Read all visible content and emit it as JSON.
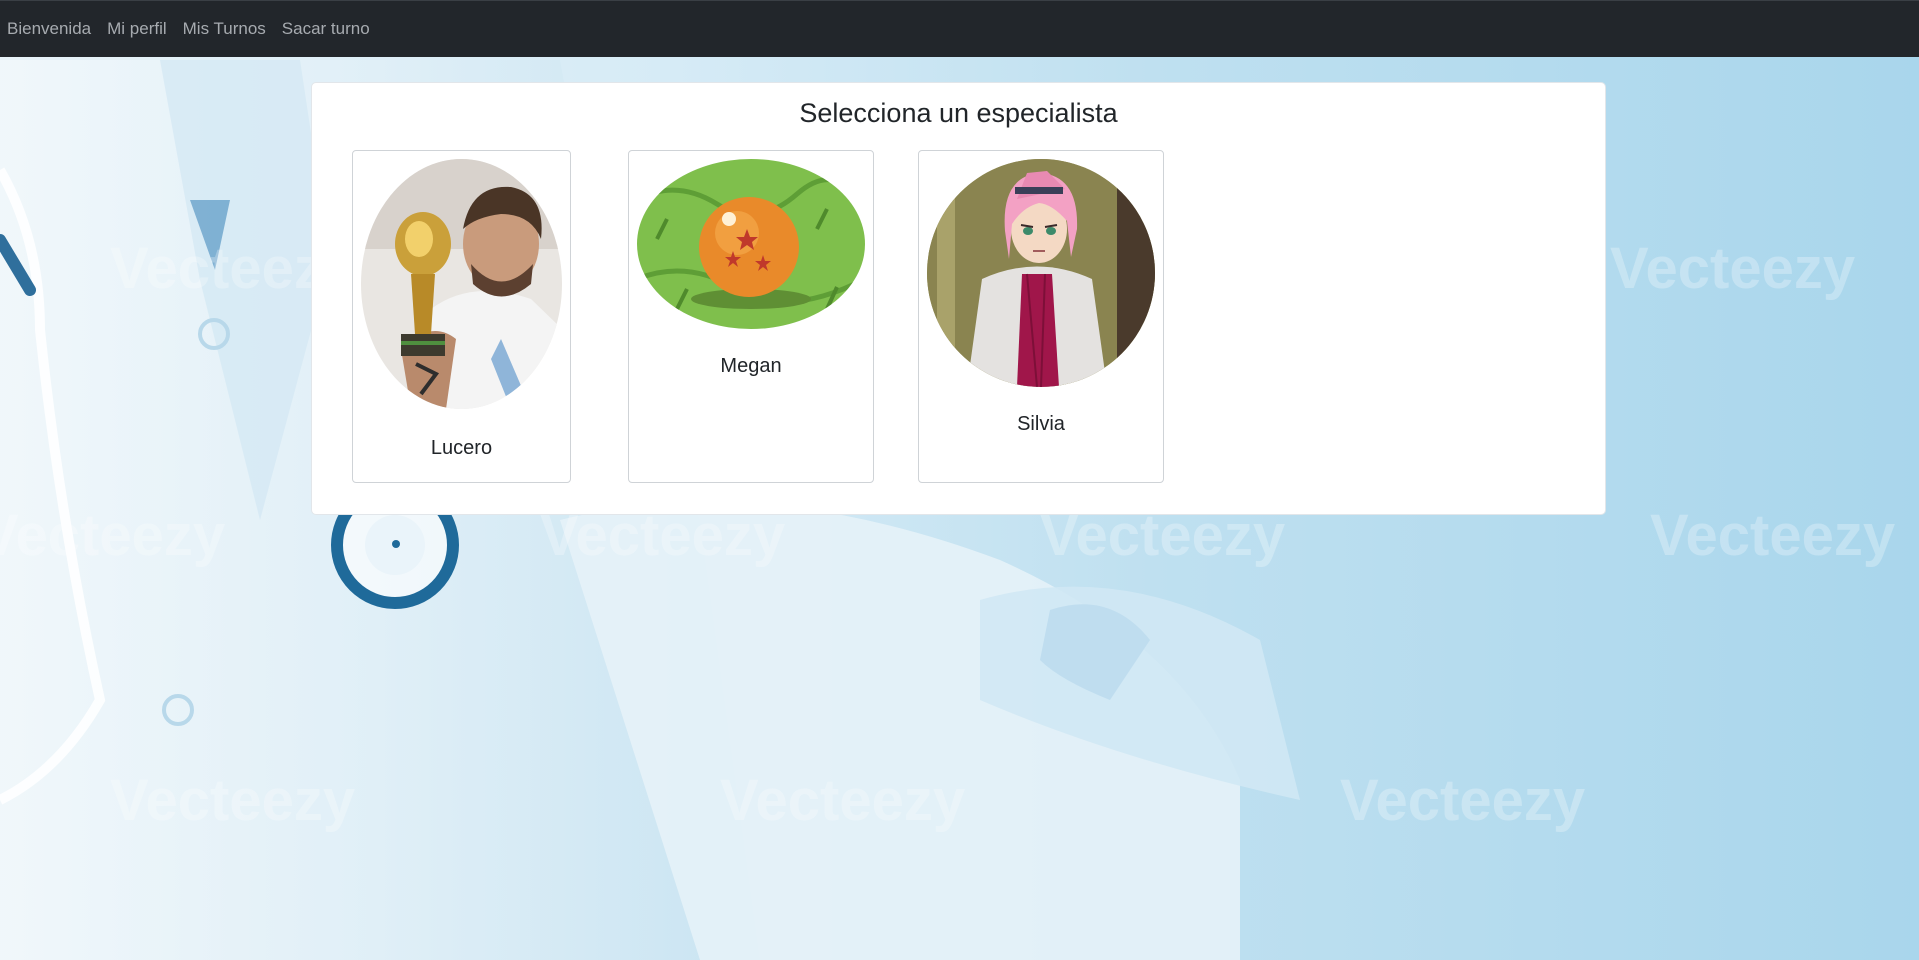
{
  "navbar": {
    "items": [
      {
        "label": "Bienvenida"
      },
      {
        "label": "Mi perfil"
      },
      {
        "label": "Mis Turnos"
      },
      {
        "label": "Sacar turno"
      }
    ]
  },
  "main": {
    "title": "Selecciona un especialista",
    "specialists": [
      {
        "name": "Lucero",
        "photo_icon": "trophy-selfie-photo"
      },
      {
        "name": "Megan",
        "photo_icon": "orange-ball-on-grass-photo"
      },
      {
        "name": "Silvia",
        "photo_icon": "pink-haired-anime-character-photo"
      }
    ]
  },
  "background": {
    "watermark": "Vecteezy",
    "colors": {
      "navbar": "#22262b",
      "panel": "#ffffff",
      "background": "#bfe0f0"
    }
  }
}
